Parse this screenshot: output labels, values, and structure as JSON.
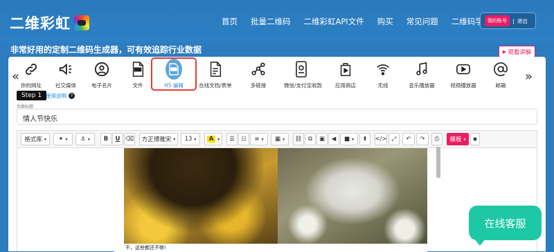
{
  "brand": {
    "name": "二维彩虹"
  },
  "nav": [
    "首页",
    "批量二维码",
    "二维彩虹API文件",
    "购买",
    "常见问题",
    "二维码学院"
  ],
  "account": {
    "my_account": "我的账号",
    "sep": "|",
    "logout": "退出"
  },
  "tagline": "非常好用的定制二维码生成器，可有效追踪行业数据",
  "demo_button": "观看讲解",
  "tools": [
    {
      "label": "你的网址",
      "icon": "link-icon"
    },
    {
      "label": "社交媒体",
      "icon": "megaphone-icon"
    },
    {
      "label": "电子名片",
      "icon": "user-icon"
    },
    {
      "label": "文件",
      "icon": "pdf-file-icon"
    },
    {
      "label": "H5 编辑",
      "icon": "html-file-icon",
      "active": true
    },
    {
      "label": "在线文档/表单",
      "icon": "document-icon"
    },
    {
      "label": "多链接",
      "icon": "multi-link-icon"
    },
    {
      "label": "微信/支付宝收款",
      "icon": "payment-icon"
    },
    {
      "label": "应用商店",
      "icon": "app-store-icon"
    },
    {
      "label": "无线",
      "icon": "wifi-icon"
    },
    {
      "label": "音乐播放器",
      "icon": "music-icon"
    },
    {
      "label": "视频播放器",
      "icon": "video-icon"
    },
    {
      "label": "邮箱",
      "icon": "at-icon"
    }
  ],
  "step": "Step 1",
  "usage_label": "使用说明",
  "title_field": {
    "label": "页面标题",
    "value": "情人节快乐"
  },
  "toolbar": {
    "style_lib": "格式库",
    "font": "方正博雅宋",
    "size": "13",
    "template": "模板"
  },
  "content": {
    "caption": "不，这些都还不够!"
  },
  "chat_button": "在线客服",
  "colors": {
    "brand_blue": "#2d7cbf",
    "accent_pink": "#e91e63",
    "chat_green": "#1ec8a5",
    "highlight_red": "#e53935"
  }
}
